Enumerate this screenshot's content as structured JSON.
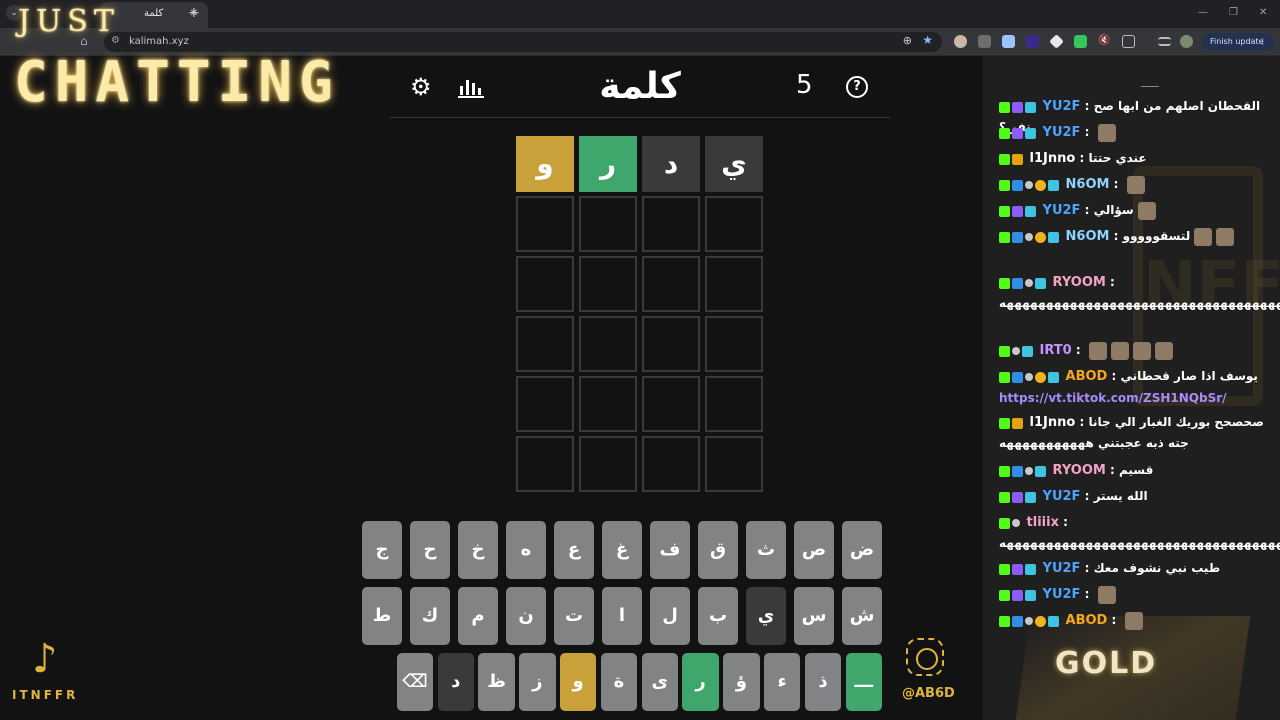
{
  "browser": {
    "tab_title": "كلمة",
    "url": "kalimah.xyz",
    "finish_update": "Finish update"
  },
  "overlay": {
    "just": "JUST",
    "chatting": "CHATTING",
    "tiktok_name": "ITNFFR",
    "insta_handle": "@AB6D",
    "gold": "GOLD",
    "watermark": "NFFR"
  },
  "game": {
    "title": "كلمة",
    "streak": "5",
    "help": "?",
    "board": [
      [
        {
          "letter": "ي",
          "state": "absent"
        },
        {
          "letter": "د",
          "state": "absent"
        },
        {
          "letter": "ر",
          "state": "correct"
        },
        {
          "letter": "و",
          "state": "present"
        }
      ],
      [
        {
          "letter": "",
          "state": "empty"
        },
        {
          "letter": "",
          "state": "empty"
        },
        {
          "letter": "",
          "state": "empty"
        },
        {
          "letter": "",
          "state": "empty"
        }
      ],
      [
        {
          "letter": "",
          "state": "empty"
        },
        {
          "letter": "",
          "state": "empty"
        },
        {
          "letter": "",
          "state": "empty"
        },
        {
          "letter": "",
          "state": "empty"
        }
      ],
      [
        {
          "letter": "",
          "state": "empty"
        },
        {
          "letter": "",
          "state": "empty"
        },
        {
          "letter": "",
          "state": "empty"
        },
        {
          "letter": "",
          "state": "empty"
        }
      ],
      [
        {
          "letter": "",
          "state": "empty"
        },
        {
          "letter": "",
          "state": "empty"
        },
        {
          "letter": "",
          "state": "empty"
        },
        {
          "letter": "",
          "state": "empty"
        }
      ],
      [
        {
          "letter": "",
          "state": "empty"
        },
        {
          "letter": "",
          "state": "empty"
        },
        {
          "letter": "",
          "state": "empty"
        },
        {
          "letter": "",
          "state": "empty"
        }
      ]
    ],
    "keyboard": [
      [
        {
          "k": "ض",
          "s": ""
        },
        {
          "k": "ص",
          "s": ""
        },
        {
          "k": "ث",
          "s": ""
        },
        {
          "k": "ق",
          "s": ""
        },
        {
          "k": "ف",
          "s": ""
        },
        {
          "k": "غ",
          "s": ""
        },
        {
          "k": "ع",
          "s": ""
        },
        {
          "k": "ه",
          "s": ""
        },
        {
          "k": "خ",
          "s": ""
        },
        {
          "k": "ح",
          "s": ""
        },
        {
          "k": "ج",
          "s": ""
        }
      ],
      [
        {
          "k": "ش",
          "s": ""
        },
        {
          "k": "س",
          "s": ""
        },
        {
          "k": "ي",
          "s": "absent"
        },
        {
          "k": "ب",
          "s": ""
        },
        {
          "k": "ل",
          "s": ""
        },
        {
          "k": "ا",
          "s": ""
        },
        {
          "k": "ت",
          "s": ""
        },
        {
          "k": "ن",
          "s": ""
        },
        {
          "k": "م",
          "s": ""
        },
        {
          "k": "ك",
          "s": ""
        },
        {
          "k": "ط",
          "s": ""
        }
      ],
      [
        {
          "k": "ـــ",
          "s": "correct"
        },
        {
          "k": "ذ",
          "s": ""
        },
        {
          "k": "ء",
          "s": ""
        },
        {
          "k": "ؤ",
          "s": ""
        },
        {
          "k": "ر",
          "s": "correct"
        },
        {
          "k": "ى",
          "s": ""
        },
        {
          "k": "ة",
          "s": ""
        },
        {
          "k": "و",
          "s": "present"
        },
        {
          "k": "ز",
          "s": ""
        },
        {
          "k": "ظ",
          "s": ""
        },
        {
          "k": "د",
          "s": "absent"
        },
        {
          "k": "⌫",
          "s": ""
        }
      ]
    ]
  },
  "chat": {
    "messages": [
      {
        "badges": [
          "k",
          "cube",
          "pix"
        ],
        "user": "YU2F",
        "color": "c-blue",
        "text": "القحطان اصلهم من ابها صح نفر ؟",
        "emotes": 0
      },
      {
        "badges": [
          "k",
          "cube",
          "pix"
        ],
        "user": "YU2F",
        "color": "c-blue",
        "text": "",
        "emotes": 1
      },
      {
        "badges": [
          "k",
          "crown"
        ],
        "user": "l1Jnno",
        "color": "c-white",
        "text": "عندي حتتا",
        "emotes": 0
      },
      {
        "badges": [
          "k",
          "blue",
          "seal",
          "one",
          "pix"
        ],
        "user": "N6OM",
        "color": "c-cyan",
        "text": "",
        "emotes": 1
      },
      {
        "badges": [
          "k",
          "cube",
          "pix"
        ],
        "user": "YU2F",
        "color": "c-blue",
        "text": "سؤالي",
        "emotes": 1
      },
      {
        "badges": [
          "k",
          "blue",
          "seal",
          "one",
          "pix"
        ],
        "user": "N6OM",
        "color": "c-cyan",
        "text": "لتسقووووو",
        "emotes": 2
      },
      {
        "badges": [
          "k",
          "blue",
          "seal",
          "pix"
        ],
        "user": "RYOOM",
        "color": "c-pink",
        "text": "ههههههههههههههههههههههههههههههههههههههههههههههههههههههههه",
        "emotes": 0
      },
      {
        "badges": [
          "k",
          "seal",
          "pix"
        ],
        "user": "IRT0",
        "color": "c-violet",
        "text": "",
        "emotes": 4
      },
      {
        "badges": [
          "k",
          "blue",
          "seal",
          "one",
          "pix"
        ],
        "user": "ABOD",
        "color": "c-orange",
        "text": "يوسف اذا صار قحطاني",
        "emotes": 0
      },
      {
        "badges": [],
        "user": "",
        "color": "",
        "text": "https://vt.tiktok.com/ZSH1NQbSr/",
        "emotes": 0,
        "link": true
      },
      {
        "badges": [
          "k",
          "crown"
        ],
        "user": "l1Jnno",
        "color": "c-white",
        "text": "صحصحح بوريك الغبار الي جانا جته ذبه عجبتني هههههههههههه",
        "emotes": 0
      },
      {
        "badges": [
          "k",
          "blue",
          "seal",
          "pix"
        ],
        "user": "RYOOM",
        "color": "c-pink",
        "text": "قسيم",
        "emotes": 0
      },
      {
        "badges": [
          "k",
          "cube",
          "pix"
        ],
        "user": "YU2F",
        "color": "c-blue",
        "text": "الله يستر",
        "emotes": 0
      },
      {
        "badges": [
          "k",
          "seal"
        ],
        "user": "tliiix",
        "color": "c-pink",
        "text": "ههههههههههههههههههههههههههههههههههههههههههه",
        "emotes": 0
      },
      {
        "badges": [
          "k",
          "cube",
          "pix"
        ],
        "user": "YU2F",
        "color": "c-blue",
        "text": "طيب نبي نشوف معك",
        "emotes": 0
      },
      {
        "badges": [
          "k",
          "cube",
          "pix"
        ],
        "user": "YU2F",
        "color": "c-blue",
        "text": "",
        "emotes": 1
      },
      {
        "badges": [
          "k",
          "blue",
          "seal",
          "one",
          "pix"
        ],
        "user": "ABOD",
        "color": "c-orange",
        "text": "",
        "emotes": 1
      }
    ]
  },
  "colors": {
    "correct": "#3fa66c",
    "present": "#c9a13b",
    "absent": "#3a3a3c",
    "key": "#818384",
    "accent_gold": "#e0b43c"
  },
  "icons": {
    "settings": "gear-icon",
    "stats": "bar-chart-icon",
    "help": "question-circle-icon",
    "backspace": "backspace-icon"
  }
}
